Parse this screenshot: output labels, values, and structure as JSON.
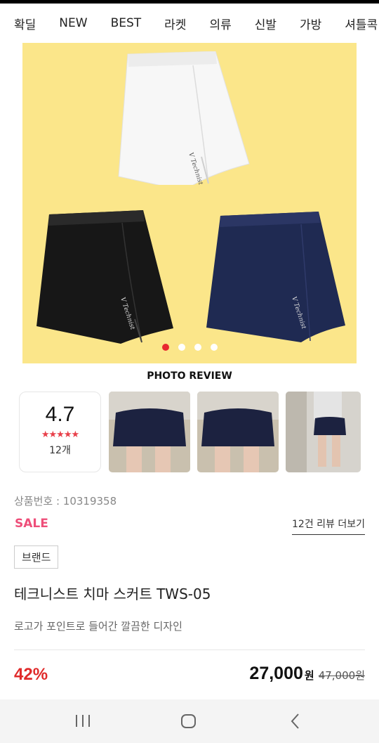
{
  "nav": {
    "items": [
      "확딜",
      "NEW",
      "BEST",
      "라켓",
      "의류",
      "신발",
      "가방",
      "셔틀콕"
    ]
  },
  "hero": {
    "background": "#fbe68a",
    "slides_total": 4,
    "active_slide": 1,
    "logo_text": "V Technist"
  },
  "photo_review": {
    "title": "PHOTO REVIEW",
    "rating": "4.7",
    "stars": "★★★★★",
    "count": "12개"
  },
  "product": {
    "number": "상품번호 : 10319358",
    "sale_label": "SALE",
    "review_link": "12건 리뷰 더보기",
    "brand_button": "브랜드",
    "title": "테크니스트 치마 스커트 TWS-05",
    "description": "로고가 포인트로 들어간 깔끔한 디자인",
    "discount": "42%",
    "price": "27,000",
    "currency": "원",
    "original_price": "47,000원"
  },
  "colors": {
    "accent_red": "#e8282f",
    "sale_pink": "#ee4e79",
    "discount_red": "#e02a2a"
  },
  "system_nav": {
    "icons": [
      "recent-apps-icon",
      "home-icon",
      "back-icon"
    ]
  }
}
